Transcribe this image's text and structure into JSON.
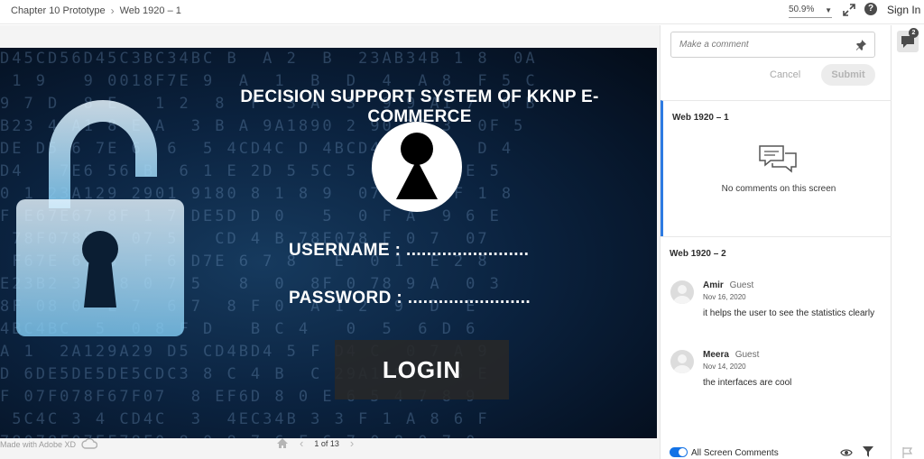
{
  "topbar": {
    "breadcrumb_project": "Chapter 10 Prototype",
    "breadcrumb_screen": "Web 1920 – 1",
    "zoom": "50.9%",
    "sign_in": "Sign In",
    "help": "?"
  },
  "artboard": {
    "title": "DECISION SUPPORT SYSTEM OF KKNP E-COMMERCE",
    "username_label": "USERNAME  : ........................",
    "password_label": "PASSWORD  : ........................",
    "login_button": "LOGIN"
  },
  "bottombar": {
    "made_with": "Made with Adobe XD",
    "page_indicator": "1 of 13"
  },
  "comments_panel": {
    "input_placeholder": "Make a comment",
    "cancel": "Cancel",
    "submit": "Submit",
    "screens": [
      {
        "title": "Web 1920 – 1",
        "empty_text": "No comments on this screen",
        "comments": []
      },
      {
        "title": "Web 1920 – 2",
        "comments": [
          {
            "author": "Amir",
            "role": "Guest",
            "date": "Nov 16, 2020",
            "text": "it helps the user to see the statistics clearly"
          },
          {
            "author": "Meera",
            "role": "Guest",
            "date": "Nov 14, 2020",
            "text": "the interfaces are cool"
          }
        ]
      }
    ],
    "footer_toggle_label": "All Screen Comments"
  },
  "rail": {
    "comment_count": "2"
  },
  "colors": {
    "accent": "#1473e6",
    "active_screen": "#2d7be2"
  }
}
